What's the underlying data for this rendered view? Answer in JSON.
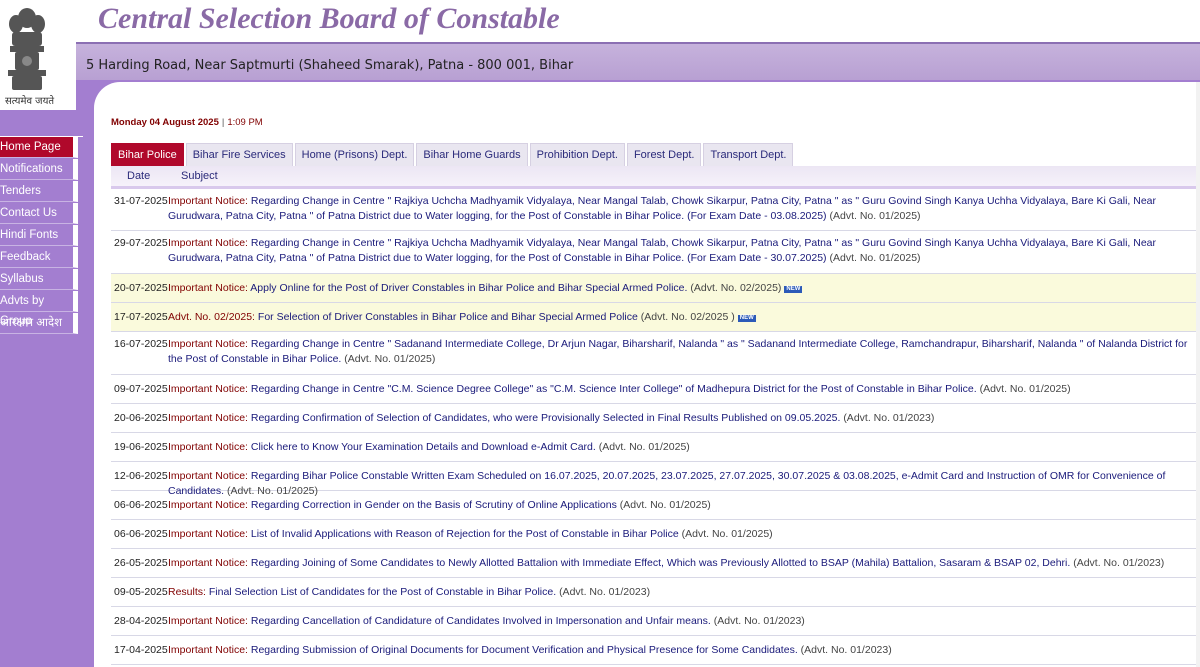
{
  "header": {
    "title": "Central Selection Board of Constable",
    "address": "5 Harding Road, Near Saptmurti (Shaheed Smarak), Patna - 800 001, Bihar",
    "emblem_motto": "सत्यमेव जयते"
  },
  "sidenav": [
    {
      "label": "Home Page",
      "active": true
    },
    {
      "label": "Notifications",
      "active": false
    },
    {
      "label": "Tenders",
      "active": false
    },
    {
      "label": "Contact Us",
      "active": false
    },
    {
      "label": "Hindi Fonts",
      "active": false
    },
    {
      "label": "Feedback",
      "active": false
    },
    {
      "label": "Syllabus",
      "active": false
    },
    {
      "label": "Advts by Group",
      "active": false
    },
    {
      "label": "आरक्षण आदेश",
      "active": false
    }
  ],
  "datetime": {
    "date": "Monday 04 August 2025",
    "separator": "|",
    "time": "1:09 PM"
  },
  "tabs": [
    {
      "label": "Bihar Police",
      "active": true
    },
    {
      "label": "Bihar Fire Services",
      "active": false
    },
    {
      "label": "Home (Prisons) Dept.",
      "active": false
    },
    {
      "label": "Bihar Home Guards",
      "active": false
    },
    {
      "label": "Prohibition Dept.",
      "active": false
    },
    {
      "label": "Forest Dept.",
      "active": false
    },
    {
      "label": "Transport Dept.",
      "active": false
    }
  ],
  "table": {
    "headers": {
      "date": "Date",
      "subject": "Subject"
    },
    "new_badge": "NEW",
    "rows": [
      {
        "date": "31-07-2025",
        "prefix": "Important Notice:",
        "text": "Regarding Change in Centre \" Rajkiya Uchcha Madhyamik Vidyalaya, Near Mangal Talab, Chowk Sikarpur, Patna City, Patna \" as \" Guru Govind Singh Kanya Uchha Vidyalaya, Bare Ki Gali, Near Gurudwara, Patna City, Patna \" of Patna District due to Water logging, for the Post of Constable in Bihar Police. (For Exam Date - 03.08.2025)",
        "advt": "(Advt. No. 01/2025)",
        "highlight": false,
        "new": false,
        "rh": 42
      },
      {
        "date": "29-07-2025",
        "prefix": "Important Notice:",
        "text": "Regarding Change in Centre \" Rajkiya Uchcha Madhyamik Vidyalaya, Near Mangal Talab, Chowk Sikarpur, Patna City, Patna \" as \" Guru Govind Singh Kanya Uchha Vidyalaya, Bare Ki Gali, Near Gurudwara, Patna City, Patna \" of Patna District due to Water logging, for the Post of Constable in Bihar Police. (For Exam Date - 30.07.2025)",
        "advt": "(Advt. No. 01/2025)",
        "highlight": false,
        "new": false,
        "rh": 43
      },
      {
        "date": "20-07-2025",
        "prefix": "Important Notice:",
        "text": "Apply Online for the Post of Driver Constables in Bihar Police and Bihar Special Armed Police.",
        "advt": "(Advt. No. 02/2025)",
        "highlight": true,
        "new": true,
        "rh": 29
      },
      {
        "date": "17-07-2025",
        "prefix": "Advt. No. 02/2025:",
        "text": "For Selection of Driver Constables in Bihar Police and Bihar Special Armed Police",
        "advt": "(Advt. No. 02/2025 )",
        "highlight": true,
        "new": true,
        "rh": 29
      },
      {
        "date": "16-07-2025",
        "prefix": "Important Notice:",
        "text": "Regarding Change in Centre \" Sadanand Intermediate College, Dr Arjun Nagar, Biharsharif, Nalanda \" as \" Sadanand Intermediate College, Ramchandrapur, Biharsharif, Nalanda \" of Nalanda District for the Post of Constable in Bihar Police.",
        "advt": "(Advt. No. 01/2025)",
        "highlight": false,
        "new": false,
        "rh": 43
      },
      {
        "date": "09-07-2025",
        "prefix": "Important Notice:",
        "text": "Regarding Change in Centre \"C.M. Science Degree College\" as \"C.M. Science Inter College\" of Madhepura District for the Post of Constable in Bihar Police.",
        "advt": "(Advt. No. 01/2025)",
        "highlight": false,
        "new": false,
        "rh": 29
      },
      {
        "date": "20-06-2025",
        "prefix": "Important Notice:",
        "text": "Regarding Confirmation of Selection of Candidates, who were Provisionally Selected in Final Results Published on 09.05.2025.",
        "advt": "(Advt. No. 01/2023)",
        "highlight": false,
        "new": false,
        "rh": 29
      },
      {
        "date": "19-06-2025",
        "prefix": "Important Notice:",
        "text": "Click here to Know Your Examination Details and Download e-Admit Card.",
        "advt": "(Advt. No. 01/2025)",
        "highlight": false,
        "new": false,
        "rh": 29
      },
      {
        "date": "12-06-2025",
        "prefix": "Important Notice:",
        "text": "Regarding Bihar Police Constable Written Exam Scheduled on 16.07.2025, 20.07.2025, 23.07.2025, 27.07.2025, 30.07.2025 & 03.08.2025, e-Admit Card and Instruction of OMR for Convenience of Candidates.",
        "advt": "(Advt. No. 01/2025)",
        "highlight": false,
        "new": false,
        "rh": 29
      },
      {
        "date": "06-06-2025",
        "prefix": "Important Notice:",
        "text": "Regarding Correction in Gender on the Basis of Scrutiny of Online Applications",
        "advt": "(Advt. No. 01/2025)",
        "highlight": false,
        "new": false,
        "rh": 29
      },
      {
        "date": "06-06-2025",
        "prefix": "Important Notice:",
        "text": "List of Invalid Applications with Reason of Rejection for the Post of Constable in Bihar Police",
        "advt": "(Advt. No. 01/2025)",
        "highlight": false,
        "new": false,
        "rh": 29
      },
      {
        "date": "26-05-2025",
        "prefix": "Important Notice:",
        "text": "Regarding Joining of Some Candidates to Newly Allotted Battalion with Immediate Effect, Which was Previously Allotted to BSAP (Mahila) Battalion, Sasaram & BSAP 02, Dehri.",
        "advt": "(Advt. No. 01/2023)",
        "highlight": false,
        "new": false,
        "rh": 29
      },
      {
        "date": "09-05-2025",
        "prefix": "Results:",
        "text": "Final Selection List of Candidates for the Post of Constable in Bihar Police.",
        "advt": "(Advt. No. 01/2023)",
        "highlight": false,
        "new": false,
        "rh": 29
      },
      {
        "date": "28-04-2025",
        "prefix": "Important Notice:",
        "text": "Regarding Cancellation of Candidature of Candidates Involved in Impersonation and Unfair means.",
        "advt": "(Advt. No. 01/2023)",
        "highlight": false,
        "new": false,
        "rh": 29
      },
      {
        "date": "17-04-2025",
        "prefix": "Important Notice:",
        "text": "Regarding Submission of Original Documents for Document Verification and Physical Presence for Some Candidates.",
        "advt": "(Advt. No. 01/2023)",
        "highlight": false,
        "new": false,
        "rh": 29
      }
    ]
  }
}
